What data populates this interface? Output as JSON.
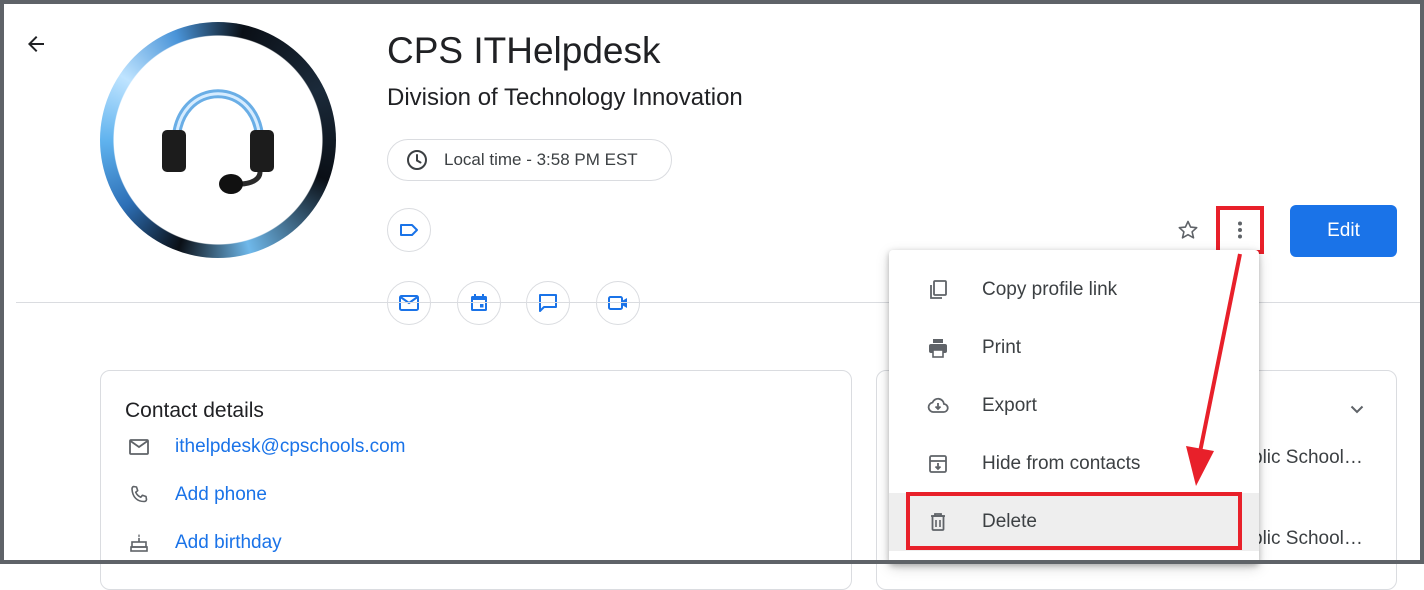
{
  "contact": {
    "name": "CPS ITHelpdesk",
    "organization": "Division of Technology Innovation",
    "local_time": "Local time - 3:58 PM EST"
  },
  "actions": {
    "edit_label": "Edit"
  },
  "contact_details": {
    "title": "Contact details",
    "email": "ithelpdesk@cpschools.com",
    "add_phone": "Add phone",
    "add_birthday": "Add birthday"
  },
  "right_card": {
    "line1": "blic School…",
    "line2": "blic School…"
  },
  "menu": {
    "items": [
      {
        "label": "Copy profile link",
        "icon": "copy-link-icon"
      },
      {
        "label": "Print",
        "icon": "print-icon"
      },
      {
        "label": "Export",
        "icon": "export-icon"
      },
      {
        "label": "Hide from contacts",
        "icon": "hide-icon"
      },
      {
        "label": "Delete",
        "icon": "trash-icon"
      }
    ]
  },
  "colors": {
    "accent": "#1a73e8",
    "annotation": "#e8202a"
  }
}
